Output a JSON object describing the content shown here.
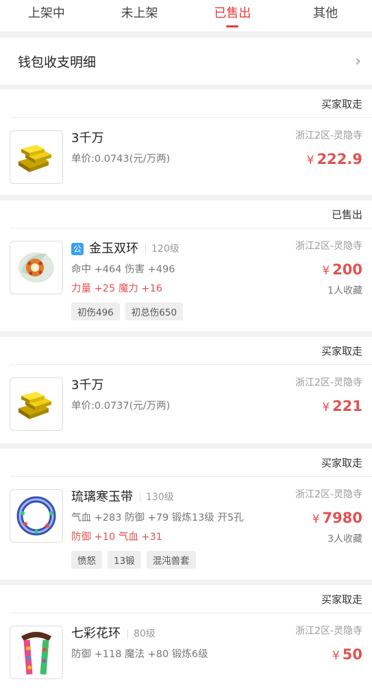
{
  "tabs": [
    {
      "label": "上架中"
    },
    {
      "label": "未上架"
    },
    {
      "label": "已售出"
    },
    {
      "label": "其他"
    }
  ],
  "active_tab": 2,
  "wallet": {
    "label": "钱包收支明细"
  },
  "items": [
    {
      "status": "买家取走",
      "title": "3千万",
      "line1": "单价:0.0743(元/万两)",
      "server": "浙江2区-灵隐寺",
      "currency": "¥",
      "price": "222.9"
    },
    {
      "status": "已售出",
      "badge": "公",
      "title": "金玉双环",
      "level": "120级",
      "line1": "命中 +464 伤害 +496",
      "line2": "力量 +25 魔力 +16",
      "tags": [
        "初伤496",
        "初总伤650"
      ],
      "server": "浙江2区-灵隐寺",
      "currency": "¥",
      "price": "200",
      "fav": "1人收藏"
    },
    {
      "status": "买家取走",
      "title": "3千万",
      "line1": "单价:0.0737(元/万两)",
      "server": "浙江2区-灵隐寺",
      "currency": "¥",
      "price": "221"
    },
    {
      "status": "买家取走",
      "title": "琉璃寒玉带",
      "level": "130级",
      "line1": "气血 +283 防御 +79 锻炼13级 开5孔",
      "line2": "防御 +10 气血 +31",
      "tags": [
        "愤怒",
        "13锻",
        "混沌兽套"
      ],
      "server": "浙江2区-灵隐寺",
      "currency": "¥",
      "price": "7980",
      "fav": "3人收藏"
    },
    {
      "status": "买家取走",
      "title": "七彩花环",
      "level": "80级",
      "line1": "防御 +118 魔法 +80 锻炼6级",
      "server": "浙江2区-灵隐寺",
      "currency": "¥",
      "price": "50"
    }
  ]
}
